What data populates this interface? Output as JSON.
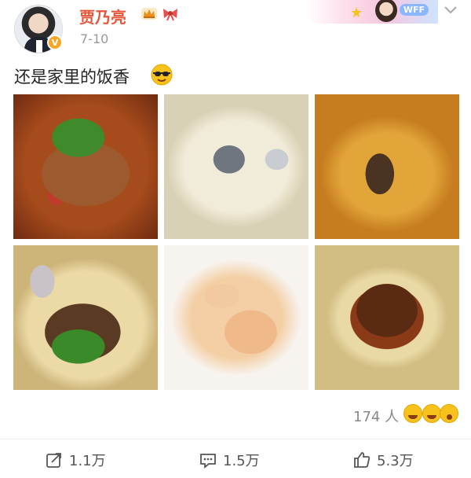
{
  "header": {
    "username": "贾乃亮",
    "post_time": "7-10",
    "verified_badge": "V",
    "banner_tag": "WFF"
  },
  "post": {
    "text": "还是家里的饭香"
  },
  "photos": [
    {
      "subject": "spicy braised fish"
    },
    {
      "subject": "fish soup"
    },
    {
      "subject": "braised fish stew"
    },
    {
      "subject": "beans and meat on flatbread"
    },
    {
      "subject": "fried shrimp"
    },
    {
      "subject": "stew with flatbread"
    }
  ],
  "reactions": {
    "count": "174 人"
  },
  "actions": {
    "repost": "1.1万",
    "comment": "1.5万",
    "like": "5.3万"
  },
  "colors": {
    "username": "#e5563a",
    "secondary_text": "#999999",
    "badge": "#f6a623"
  },
  "icons": [
    "crown-icon",
    "bow-icon",
    "chevron-down-icon",
    "sunglasses-emoji",
    "repost-icon",
    "comment-icon",
    "like-icon"
  ]
}
